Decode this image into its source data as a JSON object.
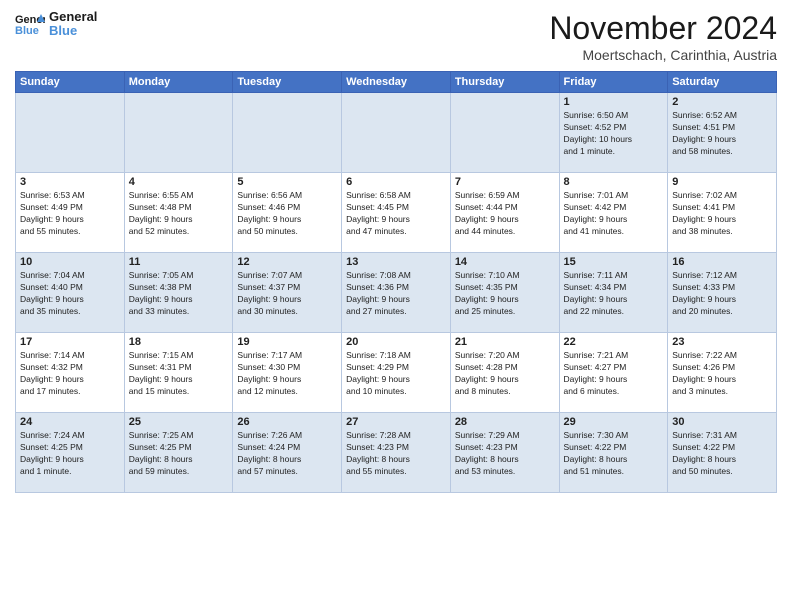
{
  "logo": {
    "line1": "General",
    "line2": "Blue"
  },
  "title": "November 2024",
  "location": "Moertschach, Carinthia, Austria",
  "weekdays": [
    "Sunday",
    "Monday",
    "Tuesday",
    "Wednesday",
    "Thursday",
    "Friday",
    "Saturday"
  ],
  "weeks": [
    [
      {
        "day": "",
        "info": ""
      },
      {
        "day": "",
        "info": ""
      },
      {
        "day": "",
        "info": ""
      },
      {
        "day": "",
        "info": ""
      },
      {
        "day": "",
        "info": ""
      },
      {
        "day": "1",
        "info": "Sunrise: 6:50 AM\nSunset: 4:52 PM\nDaylight: 10 hours\nand 1 minute."
      },
      {
        "day": "2",
        "info": "Sunrise: 6:52 AM\nSunset: 4:51 PM\nDaylight: 9 hours\nand 58 minutes."
      }
    ],
    [
      {
        "day": "3",
        "info": "Sunrise: 6:53 AM\nSunset: 4:49 PM\nDaylight: 9 hours\nand 55 minutes."
      },
      {
        "day": "4",
        "info": "Sunrise: 6:55 AM\nSunset: 4:48 PM\nDaylight: 9 hours\nand 52 minutes."
      },
      {
        "day": "5",
        "info": "Sunrise: 6:56 AM\nSunset: 4:46 PM\nDaylight: 9 hours\nand 50 minutes."
      },
      {
        "day": "6",
        "info": "Sunrise: 6:58 AM\nSunset: 4:45 PM\nDaylight: 9 hours\nand 47 minutes."
      },
      {
        "day": "7",
        "info": "Sunrise: 6:59 AM\nSunset: 4:44 PM\nDaylight: 9 hours\nand 44 minutes."
      },
      {
        "day": "8",
        "info": "Sunrise: 7:01 AM\nSunset: 4:42 PM\nDaylight: 9 hours\nand 41 minutes."
      },
      {
        "day": "9",
        "info": "Sunrise: 7:02 AM\nSunset: 4:41 PM\nDaylight: 9 hours\nand 38 minutes."
      }
    ],
    [
      {
        "day": "10",
        "info": "Sunrise: 7:04 AM\nSunset: 4:40 PM\nDaylight: 9 hours\nand 35 minutes."
      },
      {
        "day": "11",
        "info": "Sunrise: 7:05 AM\nSunset: 4:38 PM\nDaylight: 9 hours\nand 33 minutes."
      },
      {
        "day": "12",
        "info": "Sunrise: 7:07 AM\nSunset: 4:37 PM\nDaylight: 9 hours\nand 30 minutes."
      },
      {
        "day": "13",
        "info": "Sunrise: 7:08 AM\nSunset: 4:36 PM\nDaylight: 9 hours\nand 27 minutes."
      },
      {
        "day": "14",
        "info": "Sunrise: 7:10 AM\nSunset: 4:35 PM\nDaylight: 9 hours\nand 25 minutes."
      },
      {
        "day": "15",
        "info": "Sunrise: 7:11 AM\nSunset: 4:34 PM\nDaylight: 9 hours\nand 22 minutes."
      },
      {
        "day": "16",
        "info": "Sunrise: 7:12 AM\nSunset: 4:33 PM\nDaylight: 9 hours\nand 20 minutes."
      }
    ],
    [
      {
        "day": "17",
        "info": "Sunrise: 7:14 AM\nSunset: 4:32 PM\nDaylight: 9 hours\nand 17 minutes."
      },
      {
        "day": "18",
        "info": "Sunrise: 7:15 AM\nSunset: 4:31 PM\nDaylight: 9 hours\nand 15 minutes."
      },
      {
        "day": "19",
        "info": "Sunrise: 7:17 AM\nSunset: 4:30 PM\nDaylight: 9 hours\nand 12 minutes."
      },
      {
        "day": "20",
        "info": "Sunrise: 7:18 AM\nSunset: 4:29 PM\nDaylight: 9 hours\nand 10 minutes."
      },
      {
        "day": "21",
        "info": "Sunrise: 7:20 AM\nSunset: 4:28 PM\nDaylight: 9 hours\nand 8 minutes."
      },
      {
        "day": "22",
        "info": "Sunrise: 7:21 AM\nSunset: 4:27 PM\nDaylight: 9 hours\nand 6 minutes."
      },
      {
        "day": "23",
        "info": "Sunrise: 7:22 AM\nSunset: 4:26 PM\nDaylight: 9 hours\nand 3 minutes."
      }
    ],
    [
      {
        "day": "24",
        "info": "Sunrise: 7:24 AM\nSunset: 4:25 PM\nDaylight: 9 hours\nand 1 minute."
      },
      {
        "day": "25",
        "info": "Sunrise: 7:25 AM\nSunset: 4:25 PM\nDaylight: 8 hours\nand 59 minutes."
      },
      {
        "day": "26",
        "info": "Sunrise: 7:26 AM\nSunset: 4:24 PM\nDaylight: 8 hours\nand 57 minutes."
      },
      {
        "day": "27",
        "info": "Sunrise: 7:28 AM\nSunset: 4:23 PM\nDaylight: 8 hours\nand 55 minutes."
      },
      {
        "day": "28",
        "info": "Sunrise: 7:29 AM\nSunset: 4:23 PM\nDaylight: 8 hours\nand 53 minutes."
      },
      {
        "day": "29",
        "info": "Sunrise: 7:30 AM\nSunset: 4:22 PM\nDaylight: 8 hours\nand 51 minutes."
      },
      {
        "day": "30",
        "info": "Sunrise: 7:31 AM\nSunset: 4:22 PM\nDaylight: 8 hours\nand 50 minutes."
      }
    ]
  ]
}
